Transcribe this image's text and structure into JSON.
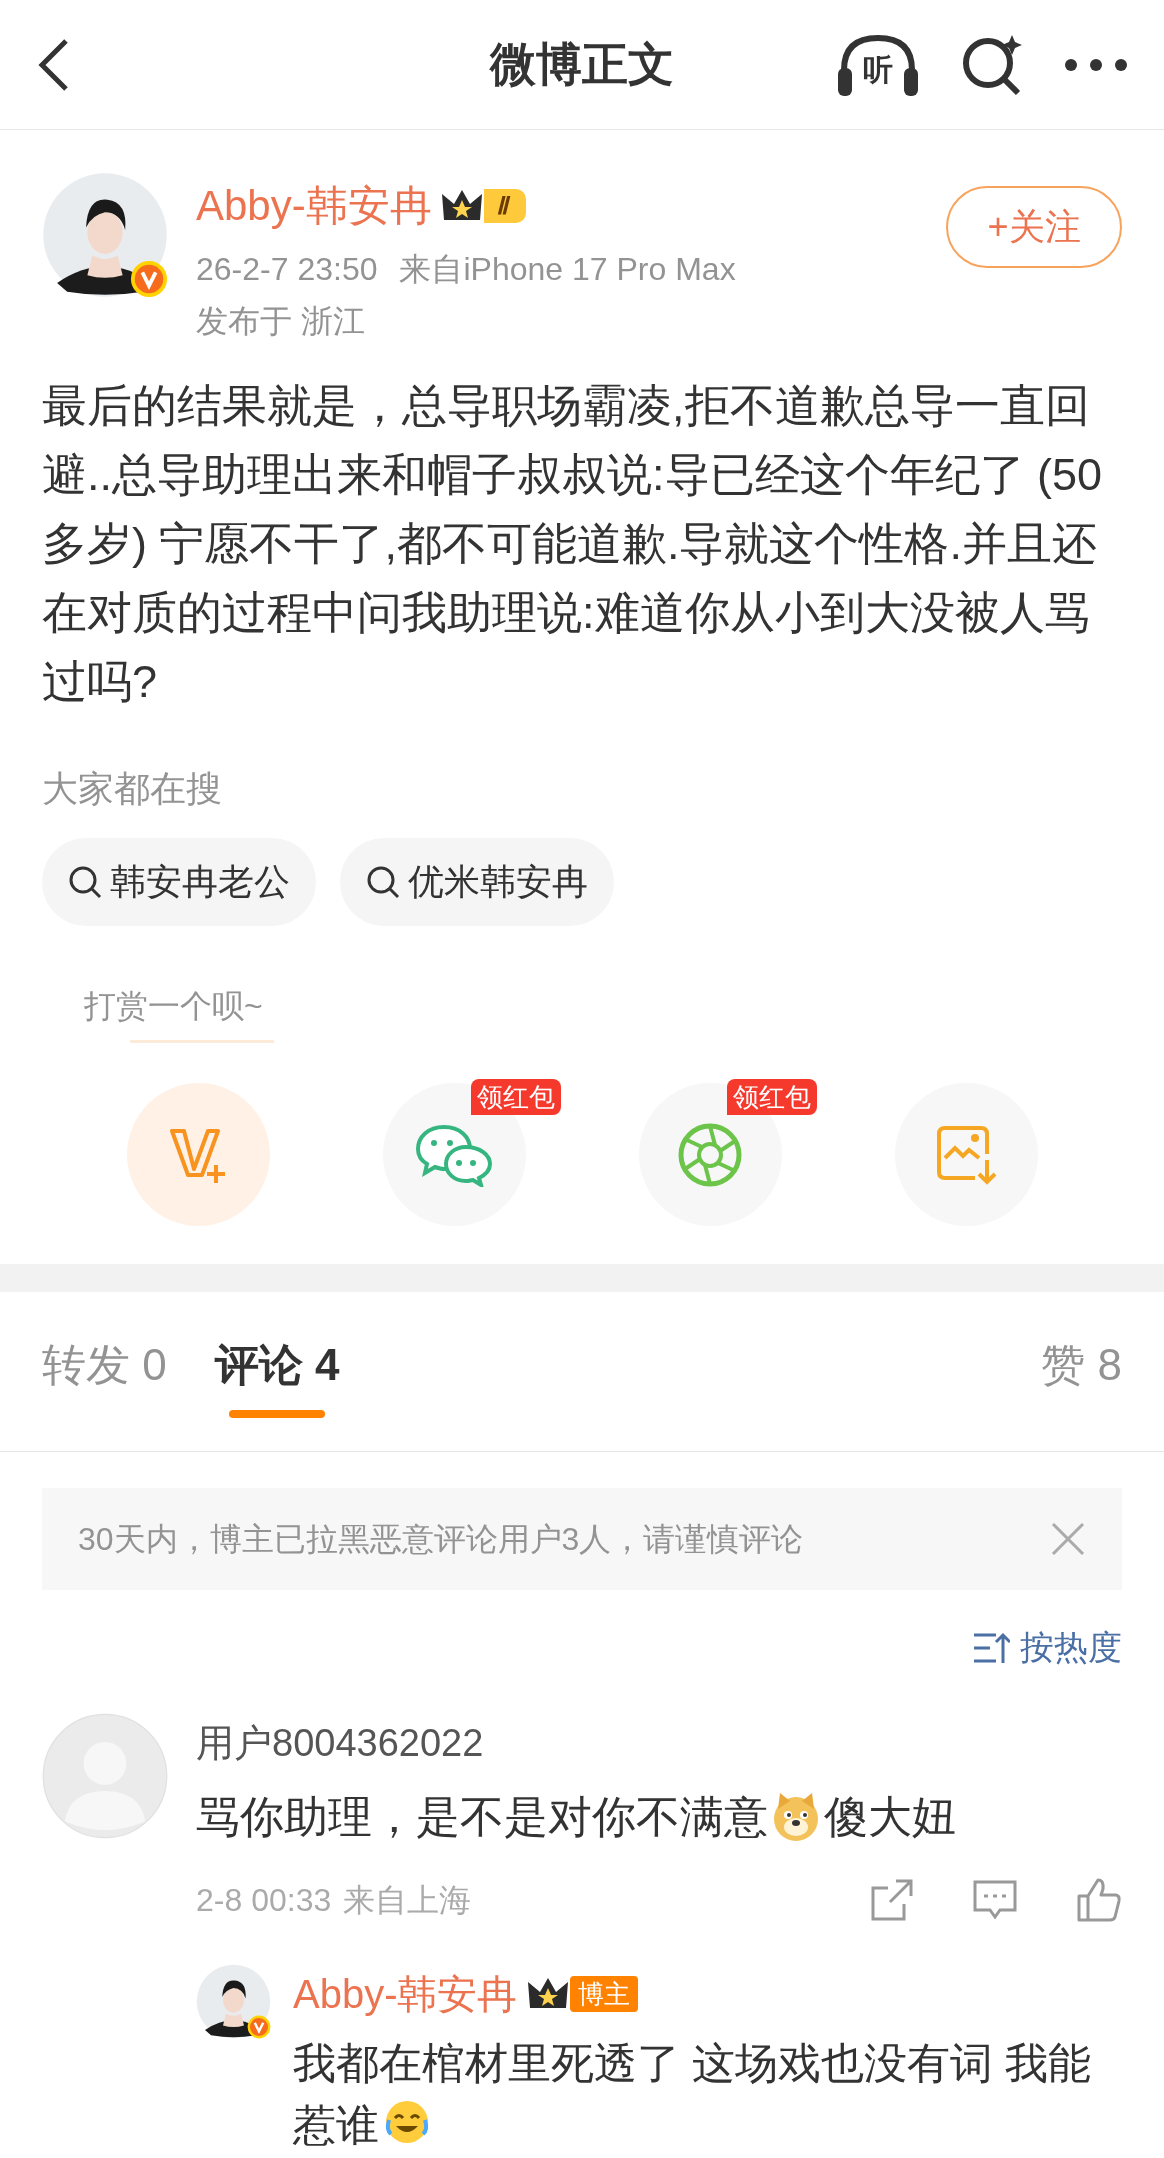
{
  "header": {
    "title": "微博正文",
    "listen_label": "听"
  },
  "post": {
    "author": "Abby-韩安冉",
    "level_badge": "Ⅱ",
    "follow_button": "+关注",
    "time": "26-2-7 23:50",
    "source": "来自iPhone 17 Pro Max",
    "location": "发布于 浙江",
    "text": "最后的结果就是，总导职场霸凌,拒不道歉总导一直回避..总导助理出来和帽子叔叔说:导已经这个年纪了 (50 多岁) 宁愿不干了,都不可能道歉.导就这个性格.并且还在对质的过程中问我助理说:难道你从小到大没被人骂过吗?"
  },
  "searches": {
    "title": "大家都在搜",
    "items": [
      "韩安冉老公",
      "优米韩安冉"
    ]
  },
  "share": {
    "tip": "打赏一个呗~",
    "items": [
      {
        "kind": "reward"
      },
      {
        "kind": "wechat",
        "badge": "领红包"
      },
      {
        "kind": "moments",
        "badge": "领红包"
      },
      {
        "kind": "save-image"
      }
    ]
  },
  "tabs": [
    {
      "label": "转发",
      "count": "0",
      "selected": false
    },
    {
      "label": "评论",
      "count": "4",
      "selected": true
    },
    {
      "label": "赞",
      "count": "8",
      "selected": false
    }
  ],
  "notice": "30天内，博主已拉黑恶意评论用户3人，请谨慎评论",
  "sort": "按热度",
  "comments": [
    {
      "user": "用户8004362022",
      "text_before": "骂你助理，是不是对你不满意",
      "text_after": "傻大妞",
      "time": "2-8 00:33",
      "location": "来自上海",
      "reply": {
        "user": "Abby-韩安冉",
        "badge": "博主",
        "text": "我都在棺材里死透了 这场戏也没有词 我能惹谁"
      }
    }
  ]
}
